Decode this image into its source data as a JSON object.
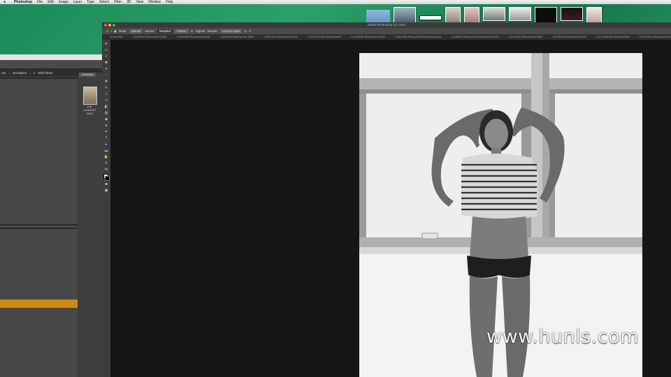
{
  "menubar": {
    "apple": "",
    "app_name": "Photoshop",
    "items": [
      "File",
      "Edit",
      "Image",
      "Layer",
      "Type",
      "Select",
      "Filter",
      "3D",
      "View",
      "Window",
      "Help"
    ]
  },
  "dock_icons": [
    "folder-icon",
    "photo-thumbnail",
    "window-thumbnail",
    "photo-thumbnail",
    "photo-thumbnail",
    "photo-thumbnail",
    "photo-thumbnail",
    "photo-thumbnail",
    "photo-thumbnail",
    "photo-thumbnail"
  ],
  "bridge": {
    "breadcrumb_left": "om",
    "breadcrumb_mid": "versatyles",
    "breadcrumb_current": "Skill Share",
    "panel_tab": "Contents",
    "file_label_1": "3 ★",
    "file_label_2": "L1004013",
    "file_label_3": ".DNG"
  },
  "photoshop": {
    "title": "Adobe Photoshop CC 2014",
    "options": {
      "mode_label": "Mode:",
      "mode_value": "Normal",
      "source_label": "Source:",
      "sampled": "Sampled",
      "pattern": "Pattern",
      "aligned": "Aligned",
      "sample_label": "Sample:",
      "sample_value": "Current Layer"
    },
    "tabs": [
      "ered.DNG",
      "L1003187-Recovered.DNG",
      "L1001055-Recovered.DNG",
      "L1000139-Recovered.DNG",
      "L1007270-Recovered.DNG",
      "L1007273-Recovered.DNG",
      "L1009969-Recovered.DNG",
      "L1163790-Recovered-Recovered.psd",
      "L1166973-Recovered-Recovered.DNG",
      "L1174240-Recovered.DNG",
      "L1174275-Recovered.DNG",
      "L1174290-Recovered.DNG",
      "L1174301-Recovered.DNG"
    ]
  },
  "watermark": "www.hunls.com",
  "colors": {
    "accent_orange": "#d08a14",
    "desktop_green": "#1f8f5d",
    "red_folder": "#ff3c3c"
  }
}
